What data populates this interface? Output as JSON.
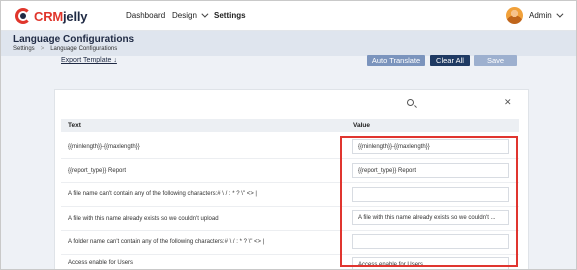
{
  "brand": {
    "crm": "CRM",
    "jelly": "jelly"
  },
  "nav": {
    "dashboard": "Dashboard",
    "design": "Design",
    "settings": "Settings",
    "user": "Admin"
  },
  "page": {
    "title": "Language Configurations",
    "breadcrumb": [
      "Settings",
      ">",
      "Language Configurations"
    ]
  },
  "toolbar": {
    "export": "Export Template ↓",
    "auto_translate": "Auto Translate",
    "clear_all": "Clear All",
    "save": "Save"
  },
  "search": {
    "value": "",
    "placeholder": ""
  },
  "table": {
    "columns": {
      "text": "Text",
      "value": "Value"
    },
    "rows": [
      {
        "text": "{{minlength}}-{{maxlength}}",
        "value": "{{minlength}}-{{maxlength}}"
      },
      {
        "text": "{{report_type}} Report",
        "value": "{{report_type}} Report"
      },
      {
        "text": "A file name can't contain any of the following characters:# \\ / : * ? \\\" <> |",
        "value": ""
      },
      {
        "text": "A file with this name already exists so we couldn't upload",
        "value": "A file with this name already exists so we couldn't ..."
      },
      {
        "text": "A folder name can't contain any of the following characters:# \\ / : * ? \\\" <> |",
        "value": ""
      },
      {
        "text": "Access enable for Users",
        "value": "Access enable for Users"
      }
    ]
  },
  "colors": {
    "highlight": "#e0352f",
    "brand_red": "#e0362c",
    "brand_navy": "#1f2a44",
    "auto_translate_btn": "#7b94bd",
    "clear_all_btn": "#1f3a63",
    "save_btn": "#9db0cf"
  }
}
